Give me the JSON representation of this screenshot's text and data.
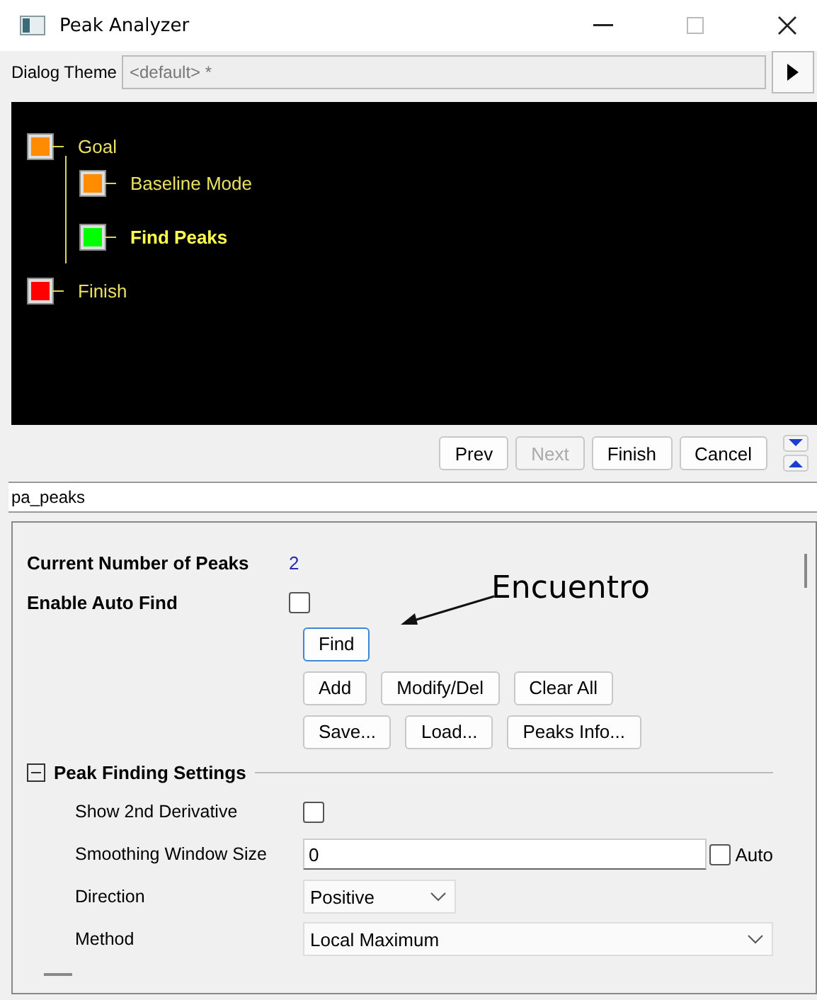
{
  "window": {
    "title": "Peak Analyzer"
  },
  "theme": {
    "label": "Dialog Theme",
    "value": "<default> *"
  },
  "tree": [
    {
      "label": "Goal",
      "color": "#ff8c00",
      "selected": false,
      "children": [
        {
          "label": "Baseline Mode",
          "color": "#ff8c00",
          "selected": false
        },
        {
          "label": "Find Peaks",
          "color": "#00ff00",
          "selected": true
        }
      ]
    },
    {
      "label": "Finish",
      "color": "#ff0000",
      "selected": false
    }
  ],
  "nav_buttons": [
    {
      "label": "Prev",
      "disabled": false
    },
    {
      "label": "Next",
      "disabled": true
    },
    {
      "label": "Finish",
      "disabled": false
    },
    {
      "label": "Cancel",
      "disabled": false
    }
  ],
  "page_name": "pa_peaks",
  "peaks": {
    "label": "Current Number of Peaks",
    "value": "2"
  },
  "auto_find": {
    "label": "Enable Auto Find",
    "checked": false
  },
  "button_rows": [
    [
      {
        "label": "Find",
        "focused": true
      }
    ],
    [
      {
        "label": "Add",
        "focused": false
      },
      {
        "label": "Modify/Del",
        "focused": false
      },
      {
        "label": "Clear All",
        "focused": false
      }
    ],
    [
      {
        "label": "Save...",
        "focused": false
      },
      {
        "label": "Load...",
        "focused": false
      },
      {
        "label": "Peaks Info...",
        "focused": false
      }
    ]
  ],
  "annotation": "Encuentro",
  "section": {
    "title": "Peak Finding Settings",
    "expanded": true
  },
  "settings": [
    {
      "kind": "checkbox",
      "label": "Show 2nd Derivative",
      "checked": false
    },
    {
      "kind": "input",
      "label": "Smoothing Window Size",
      "value": "0",
      "option": "Auto",
      "checked": false
    },
    {
      "kind": "dropdown",
      "label": "Direction",
      "value": "Positive",
      "wide": false
    },
    {
      "kind": "dropdown",
      "label": "Method",
      "value": "Local Maximum",
      "wide": true
    }
  ]
}
